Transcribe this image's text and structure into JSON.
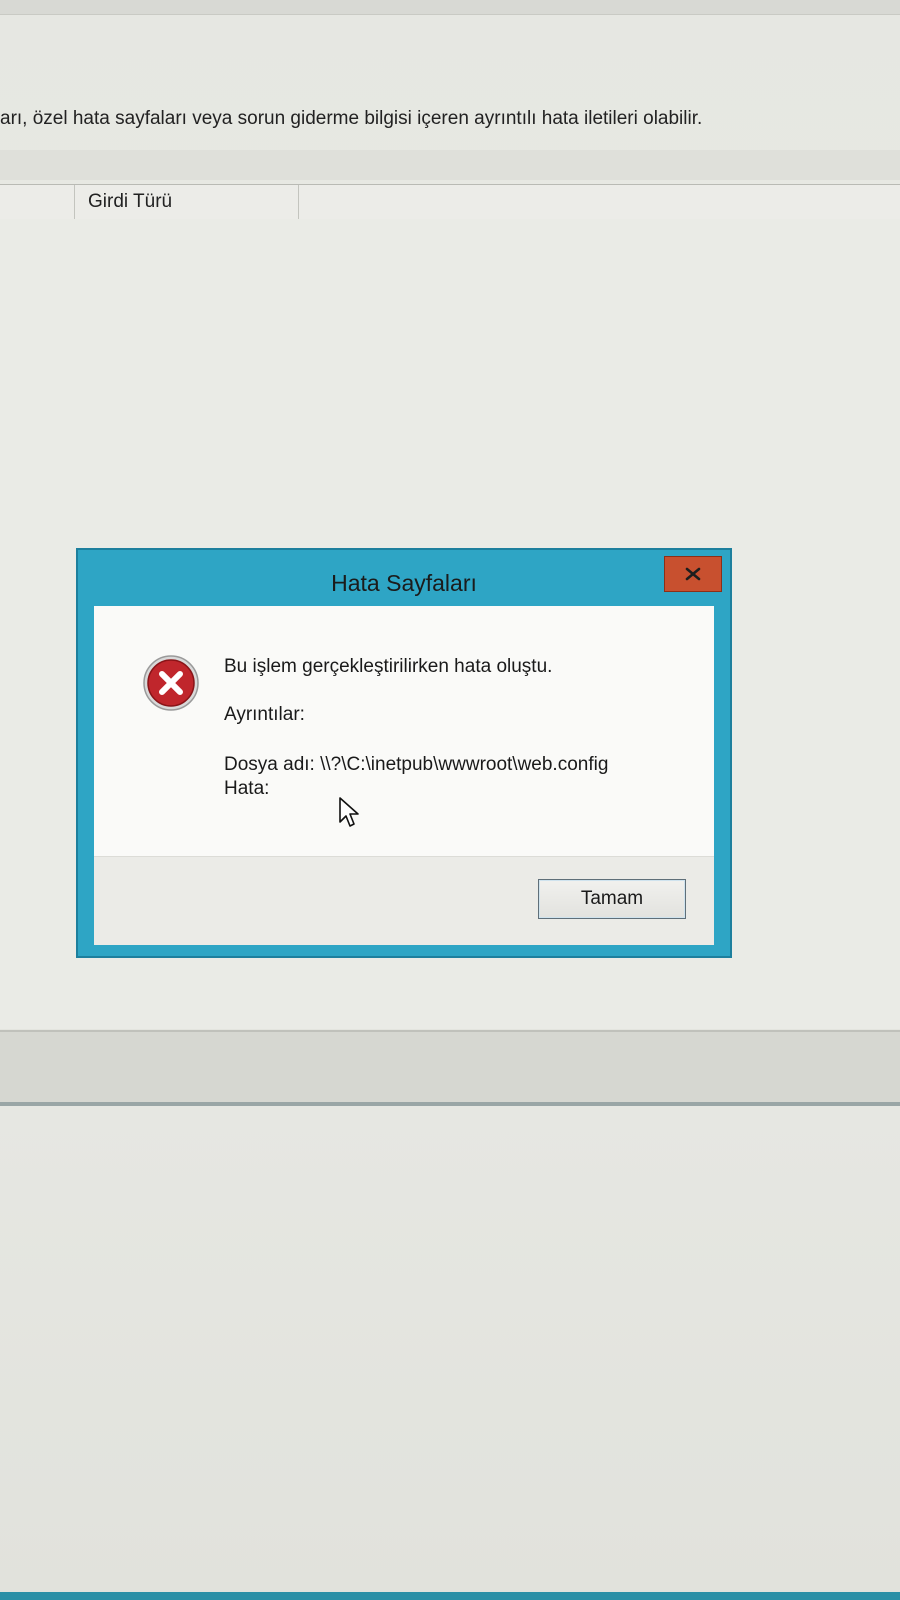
{
  "background": {
    "description_text": "arı, özel hata sayfaları veya sorun giderme bilgisi içeren ayrıntılı hata iletileri olabilir.",
    "list": {
      "columns": [
        "Girdi Türü"
      ]
    }
  },
  "dialog": {
    "title": "Hata Sayfaları",
    "close_label": "x",
    "icon": "error-icon",
    "message": "Bu işlem gerçekleştirilirken hata oluştu.",
    "details_label": "Ayrıntılar:",
    "file_line": "Dosya adı: \\\\?\\C:\\inetpub\\wwwroot\\web.config",
    "error_line": "Hata:",
    "ok_label": "Tamam"
  },
  "colors": {
    "dialog_frame": "#2ea5c5",
    "close_button": "#c8502f",
    "error_icon": "#c0262c"
  }
}
